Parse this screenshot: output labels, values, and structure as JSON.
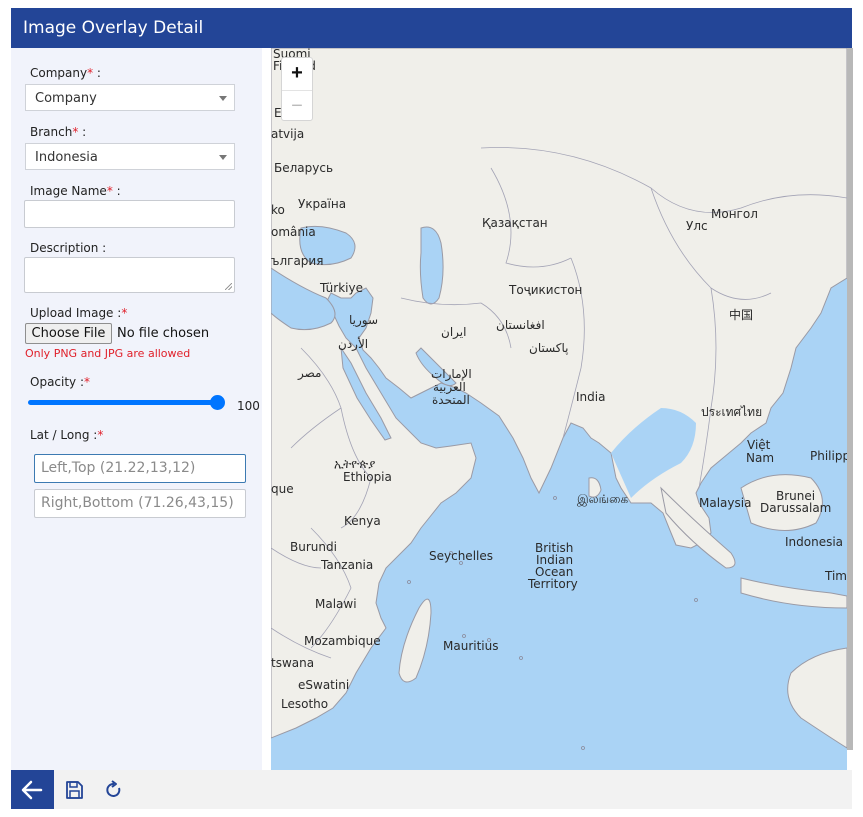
{
  "header": {
    "title": "Image Overlay Detail"
  },
  "form": {
    "company_label": "Company",
    "company_value": "Company",
    "branch_label": "Branch",
    "branch_value": "Indonesia",
    "image_name_label": "Image Name",
    "description_label": "Description :",
    "upload_label": "Upload Image :",
    "choose_file": "Choose File",
    "no_file": "No file chosen",
    "file_hint": "Only PNG and JPG are allowed",
    "opacity_label": "Opacity :",
    "opacity_value": "100",
    "opacity_level": 1.0,
    "latlong_label": "Lat / Long :",
    "left_top_placeholder": "Left,Top (21.22,13,12)",
    "right_bottom_placeholder": "Right,Bottom (71.26,43,15)",
    "required_mark": "*",
    "colon": " :"
  },
  "map": {
    "zoom_in": "+",
    "zoom_out": "−",
    "labels": [
      "Suomi",
      "Finland",
      "E",
      "atvija",
      "Беларусь",
      "ko",
      "Україна",
      "omânia",
      "ългария",
      "Türkiye",
      "سوريا",
      "الأردن",
      "مصر",
      "Қазақстан",
      "Монгол",
      "Улс",
      "Тоҷикистон",
      "ایران",
      "افغانستان",
      "پاکستان",
      "中国",
      "الإمارات",
      "العربية",
      "المتحدة",
      "India",
      "ประเทศไทย",
      "Việt",
      "Nam",
      "Philipp",
      "ኢትዮጵያ",
      "Ethiopia",
      "que",
      "Kenya",
      "Burundi",
      "Tanzania",
      "Malawi",
      "Mozambique",
      "tswana",
      "eSwatini",
      "Lesotho",
      "Seychelles",
      "British",
      "Indian",
      "Ocean",
      "Territory",
      "Mauritius",
      "இலங்கை",
      "Malaysia",
      "Brunei",
      "Darussalam",
      "Indonesia",
      "Tim"
    ]
  },
  "colors": {
    "header": "#234597",
    "accent": "#0075ff",
    "required": "#e0202a",
    "water": "#aad3f5",
    "land": "#f0efea"
  },
  "icons": {
    "back": "arrow-left-icon",
    "save": "floppy-disk-icon",
    "refresh": "refresh-icon"
  }
}
